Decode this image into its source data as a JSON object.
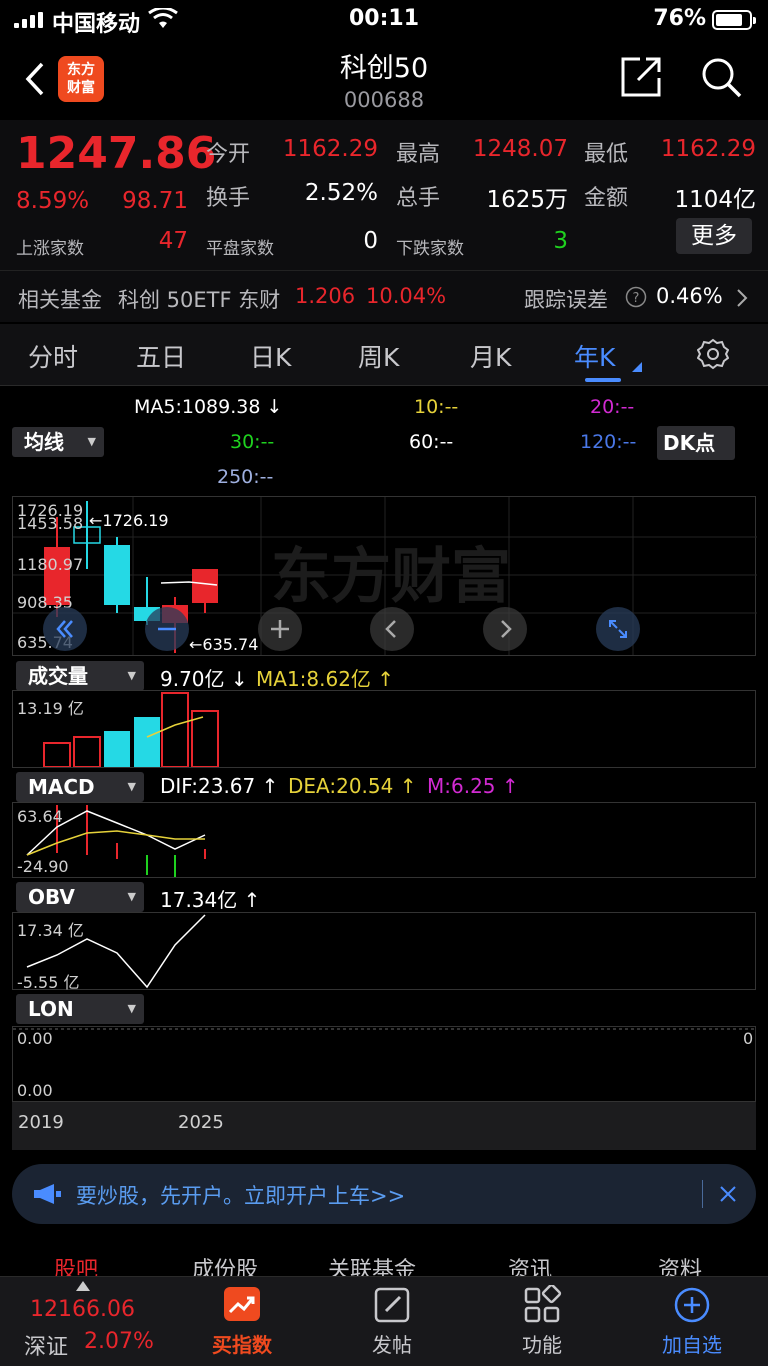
{
  "status": {
    "carrier": "中国移动",
    "time": "00:11",
    "battery": "76%"
  },
  "nav": {
    "logo": "东方财富",
    "title": "科创50",
    "code": "000688"
  },
  "quote": {
    "price": "1247.86",
    "pct": "8.59%",
    "change": "98.71",
    "open_label": "今开",
    "open": "1162.29",
    "high_label": "最高",
    "high": "1248.07",
    "low_label": "最低",
    "low": "1162.29",
    "turnover_label": "换手",
    "turnover": "2.52%",
    "volume_label": "总手",
    "volume": "1625万",
    "amount_label": "金额",
    "amount": "1104亿",
    "up_label": "上涨家数",
    "up": "47",
    "flat_label": "平盘家数",
    "flat": "0",
    "down_label": "下跌家数",
    "down": "3",
    "more": "更多"
  },
  "fund": {
    "label": "相关基金",
    "name": "科创 50ETF 东财",
    "price": "1.206",
    "pct": "10.04%",
    "track_label": "跟踪误差",
    "track": "0.46%"
  },
  "tabs": [
    "分时",
    "五日",
    "日K",
    "周K",
    "月K",
    "年K"
  ],
  "ma": {
    "selector": "均线",
    "ma5": "MA5:1089.38 ↓",
    "ma10": "10:--",
    "ma20": "20:--",
    "ma30": "30:--",
    "ma60": "60:--",
    "ma120": "120:--",
    "ma250": "250:--",
    "dk": "DK点"
  },
  "kline": {
    "axis": [
      "1726.19",
      "1453.58",
      "1180.97",
      "908.35",
      "635.74"
    ],
    "max_label": "←1726.19",
    "min_label": "←635.74",
    "watermark": "东方财富"
  },
  "volume": {
    "selector": "成交量",
    "value": "9.70亿 ↓",
    "ma1": "MA1:8.62亿 ↑",
    "axis_top": "13.19 亿"
  },
  "macd": {
    "selector": "MACD",
    "dif": "DIF:23.67 ↑",
    "dea": "DEA:20.54 ↑",
    "m": "M:6.25 ↑",
    "axis_top": "63.64",
    "axis_bottom": "-24.90"
  },
  "obv": {
    "selector": "OBV",
    "value": "17.34亿 ↑",
    "axis_top": "17.34 亿",
    "axis_bottom": "-5.55 亿"
  },
  "lon": {
    "selector": "LON",
    "axis_top": "0.00",
    "axis_bottom": "0.00",
    "right": "0"
  },
  "xaxis": [
    "2019",
    "2025"
  ],
  "banner": {
    "text": "要炒股，先开户。立即开户上车>>"
  },
  "subtabs": [
    "股吧",
    "成份股",
    "关联基金",
    "资讯",
    "资料"
  ],
  "bottom": {
    "index_value": "12166.06",
    "index_name": "深证",
    "index_pct": "2.07%",
    "items": [
      "买指数",
      "发帖",
      "功能",
      "加自选"
    ]
  },
  "colors": {
    "up": "#e8262c",
    "down": "#25d9e5",
    "accent": "#4a8cff"
  }
}
